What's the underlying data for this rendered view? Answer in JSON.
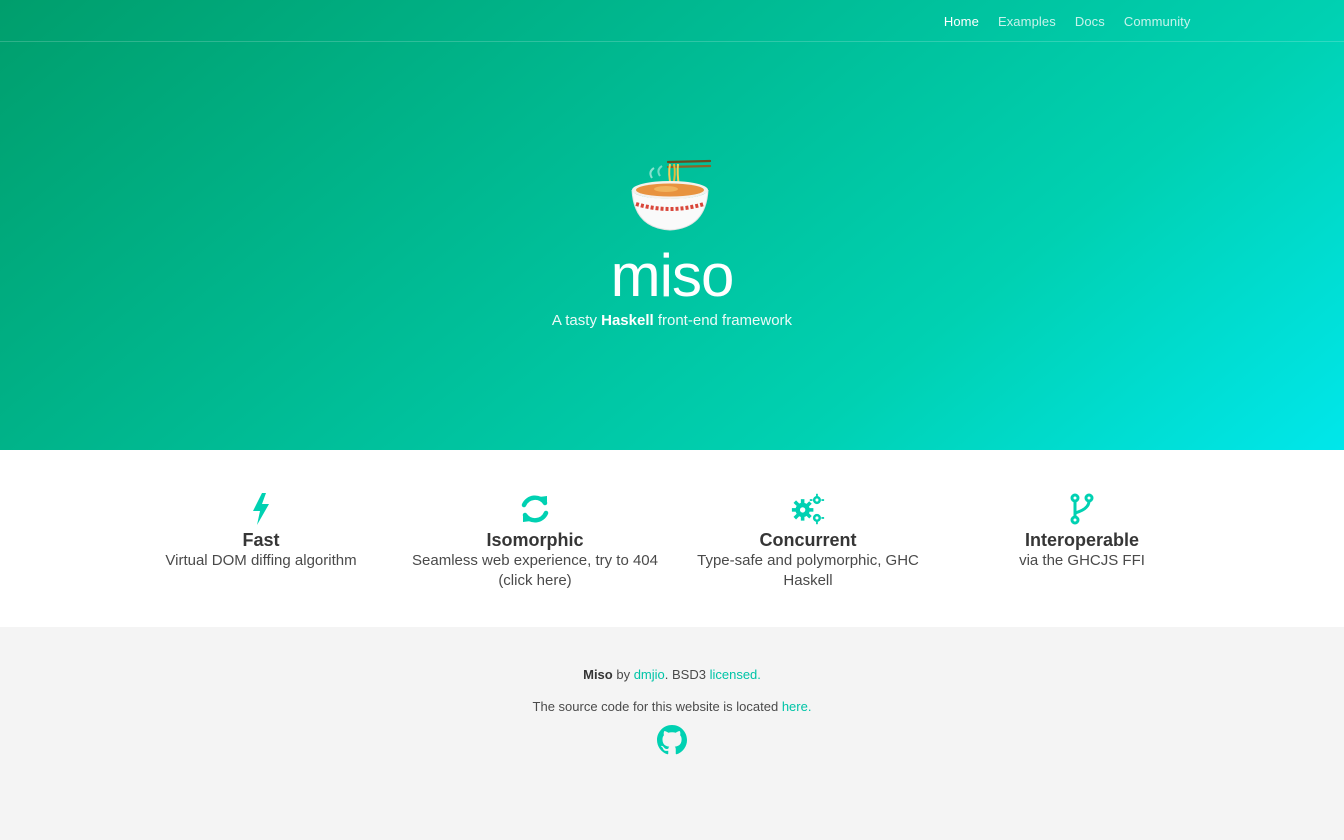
{
  "nav": {
    "items": [
      {
        "label": "Home",
        "active": true
      },
      {
        "label": "Examples",
        "active": false
      },
      {
        "label": "Docs",
        "active": false
      },
      {
        "label": "Community",
        "active": false
      }
    ]
  },
  "hero": {
    "logo_icon": "ramen-bowl-icon",
    "title": "miso",
    "subtitle_prefix": "A tasty ",
    "subtitle_strong": "Haskell",
    "subtitle_suffix": " front-end framework"
  },
  "features": [
    {
      "icon": "lightning-bolt-icon",
      "title": "Fast",
      "description": "Virtual DOM diffing algorithm"
    },
    {
      "icon": "refresh-icon",
      "title": "Isomorphic",
      "description": "Seamless web experience, try to 404 (click here)"
    },
    {
      "icon": "gears-icon",
      "title": "Concurrent",
      "description": "Type-safe and polymorphic, GHC Haskell"
    },
    {
      "icon": "code-fork-icon",
      "title": "Interoperable",
      "description": "via the GHCJS FFI"
    }
  ],
  "footer": {
    "brand": "Miso",
    "by_text": " by ",
    "author_link": "dmjio",
    "license_text": ". BSD3 ",
    "license_link": "licensed.",
    "source_text": "The source code for this website is located ",
    "source_link": "here.",
    "github_icon": "github-icon"
  },
  "colors": {
    "accent": "#00d1b2",
    "link": "#00c4a7",
    "hero_gradient_start": "#009e6c",
    "hero_gradient_end": "#00e7eb"
  }
}
